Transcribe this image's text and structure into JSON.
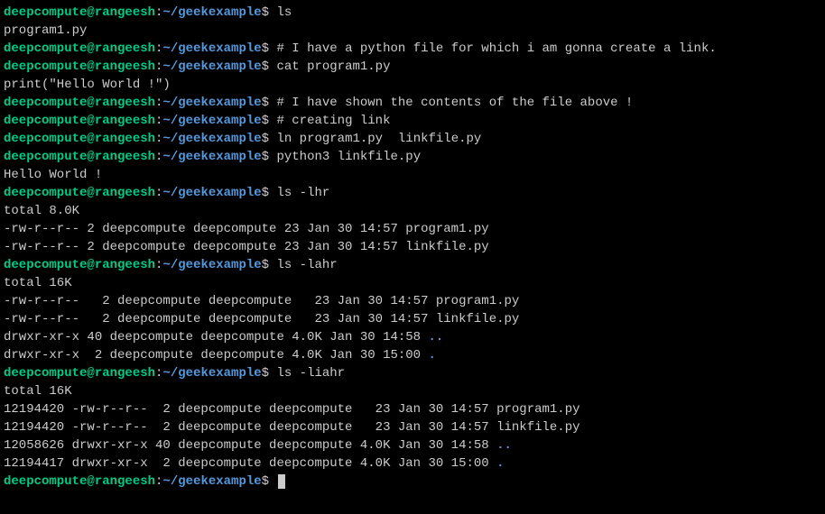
{
  "prompt": {
    "userhost": "deepcompute@rangeesh",
    "path": "~/geekexample",
    "symbol": "$"
  },
  "lines": [
    {
      "type": "prompt",
      "cmd": "ls"
    },
    {
      "type": "output",
      "text": "program1.py"
    },
    {
      "type": "prompt",
      "cmd": "# I have a python file for which i am gonna create a link."
    },
    {
      "type": "prompt",
      "cmd": "cat program1.py"
    },
    {
      "type": "output",
      "text": "print(\"Hello World !\")"
    },
    {
      "type": "prompt",
      "cmd": "# I have shown the contents of the file above !"
    },
    {
      "type": "prompt",
      "cmd": "# creating link"
    },
    {
      "type": "prompt",
      "cmd": "ln program1.py  linkfile.py"
    },
    {
      "type": "prompt",
      "cmd": "python3 linkfile.py"
    },
    {
      "type": "output",
      "text": "Hello World !"
    },
    {
      "type": "prompt",
      "cmd": "ls -lhr"
    },
    {
      "type": "output",
      "text": "total 8.0K"
    },
    {
      "type": "output",
      "text": "-rw-r--r-- 2 deepcompute deepcompute 23 Jan 30 14:57 program1.py"
    },
    {
      "type": "output",
      "text": "-rw-r--r-- 2 deepcompute deepcompute 23 Jan 30 14:57 linkfile.py"
    },
    {
      "type": "prompt",
      "cmd": "ls -lahr"
    },
    {
      "type": "output",
      "text": "total 16K"
    },
    {
      "type": "output",
      "text": "-rw-r--r--   2 deepcompute deepcompute   23 Jan 30 14:57 program1.py"
    },
    {
      "type": "output",
      "text": "-rw-r--r--   2 deepcompute deepcompute   23 Jan 30 14:57 linkfile.py"
    },
    {
      "type": "output-dir",
      "prefix": "drwxr-xr-x 40 deepcompute deepcompute 4.0K Jan 30 14:58 ",
      "dir": ".."
    },
    {
      "type": "output-dir",
      "prefix": "drwxr-xr-x  2 deepcompute deepcompute 4.0K Jan 30 15:00 ",
      "dir": "."
    },
    {
      "type": "prompt",
      "cmd": "ls -liahr"
    },
    {
      "type": "output",
      "text": "total 16K"
    },
    {
      "type": "output",
      "text": "12194420 -rw-r--r--  2 deepcompute deepcompute   23 Jan 30 14:57 program1.py"
    },
    {
      "type": "output",
      "text": "12194420 -rw-r--r--  2 deepcompute deepcompute   23 Jan 30 14:57 linkfile.py"
    },
    {
      "type": "output-dir",
      "prefix": "12058626 drwxr-xr-x 40 deepcompute deepcompute 4.0K Jan 30 14:58 ",
      "dir": ".."
    },
    {
      "type": "output-dir",
      "prefix": "12194417 drwxr-xr-x  2 deepcompute deepcompute 4.0K Jan 30 15:00 ",
      "dir": "."
    },
    {
      "type": "prompt-cursor",
      "cmd": ""
    }
  ]
}
